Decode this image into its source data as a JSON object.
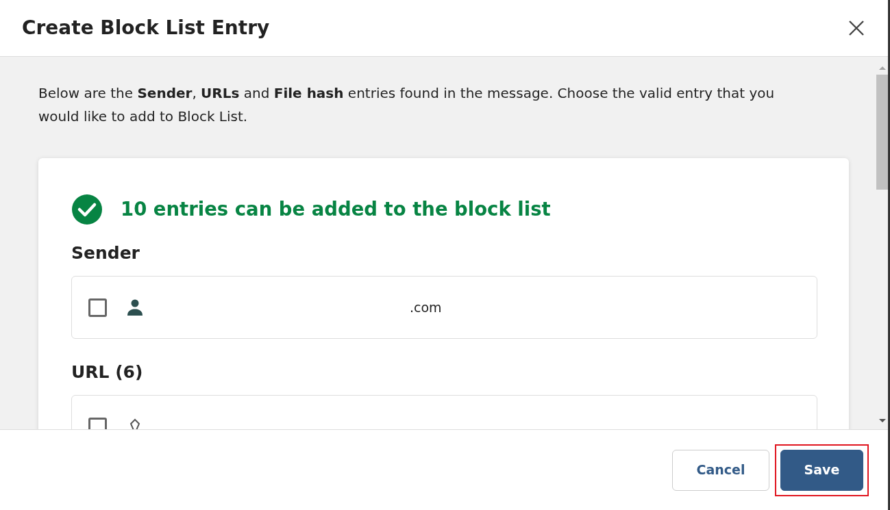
{
  "dialog": {
    "title": "Create Block List Entry"
  },
  "intro": "Below are the **Sender**, **URLs** and **File hash** entries found in the message. Choose the valid entry that you would like to add to Block List.",
  "status": {
    "kind": "success",
    "text": "10 entries can be added to the block list"
  },
  "sections": [
    {
      "heading": "Sender",
      "entries": [
        {
          "kind": "sender",
          "text": ".com",
          "checked": false
        }
      ]
    },
    {
      "heading": "URL (6)",
      "entries": [
        {
          "kind": "url",
          "checked": false
        }
      ]
    }
  ],
  "buttons": [
    {
      "label": "Cancel",
      "kind": "secondary",
      "highlighted": false
    },
    {
      "label": "Save",
      "kind": "primary",
      "highlighted": true
    }
  ]
}
